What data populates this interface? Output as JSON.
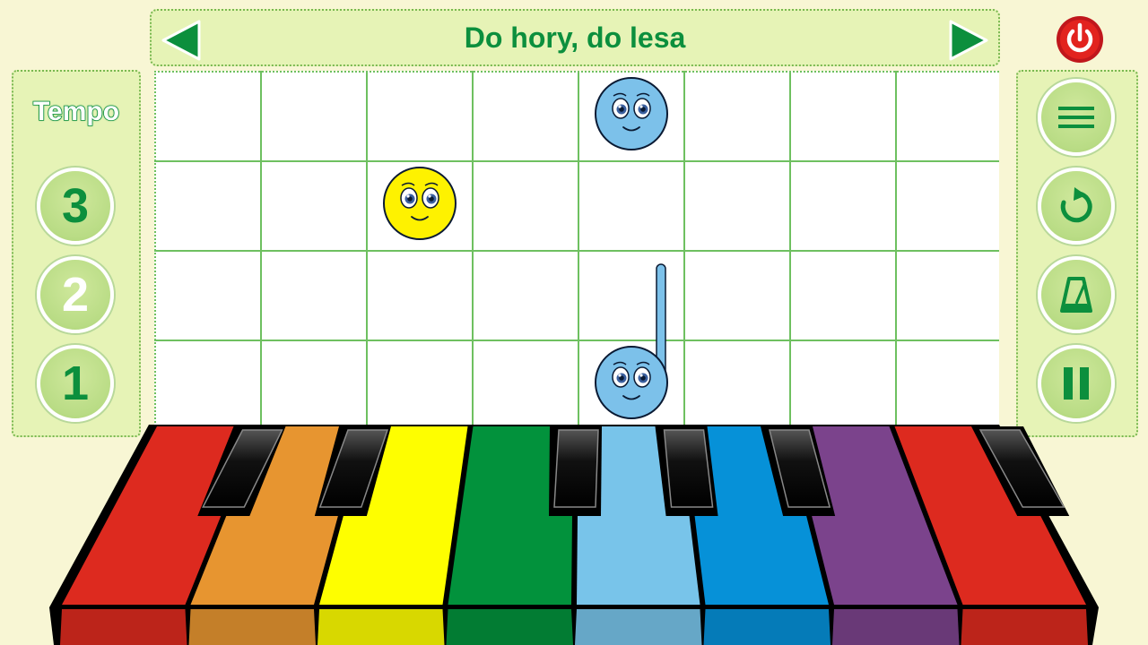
{
  "title": "Do hory, do lesa",
  "tempo": {
    "label": "Tempo",
    "options": [
      "3",
      "2",
      "1"
    ],
    "selected": "2"
  },
  "icons": {
    "prev": "triangle-left-icon",
    "next": "triangle-right-icon",
    "power": "power-icon",
    "menu": "menu-icon",
    "restart": "restart-icon",
    "metronome": "metronome-icon",
    "pause": "pause-icon"
  },
  "colors": {
    "accent": "#0c8f3d",
    "panel": "#e6f3b6",
    "background": "#f8f6d4",
    "keys": [
      "#dd2a1f",
      "#e79530",
      "#fefe00",
      "#02923c",
      "#78c4ea",
      "#0691d8",
      "#7b438c",
      "#dd2a1f"
    ]
  },
  "notes": [
    {
      "type": "whole",
      "color": "#7cc1ea",
      "column": 5,
      "row": 1
    },
    {
      "type": "whole",
      "color": "#fef200",
      "column": 3,
      "row": 2
    },
    {
      "type": "half",
      "color": "#7cc1ea",
      "column": 5,
      "row": 4
    }
  ]
}
